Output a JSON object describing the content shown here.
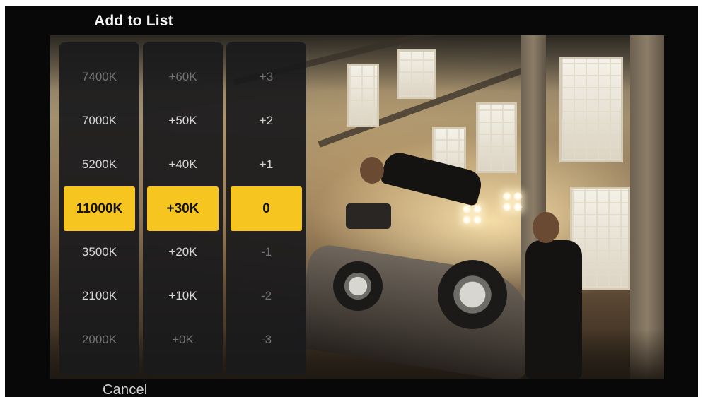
{
  "dialog": {
    "title": "Add to List",
    "cancel_label": "Cancel"
  },
  "picker": {
    "columns": [
      {
        "name": "kelvin",
        "items": [
          "7400K",
          "7000K",
          "5200K",
          "11000K",
          "3500K",
          "2100K",
          "2000K"
        ],
        "selected": "11000K"
      },
      {
        "name": "offset",
        "items": [
          "+60K",
          "+50K",
          "+40K",
          "+30K",
          "+20K",
          "+10K",
          "+0K"
        ],
        "selected": "+30K"
      },
      {
        "name": "tint",
        "items": [
          "+3",
          "+2",
          "+1",
          "0",
          "-1",
          "-2",
          "-3"
        ],
        "selected": "0"
      }
    ]
  },
  "colors": {
    "accent": "#f7c520",
    "background": "#080808",
    "panel": "#1a1a1c"
  }
}
